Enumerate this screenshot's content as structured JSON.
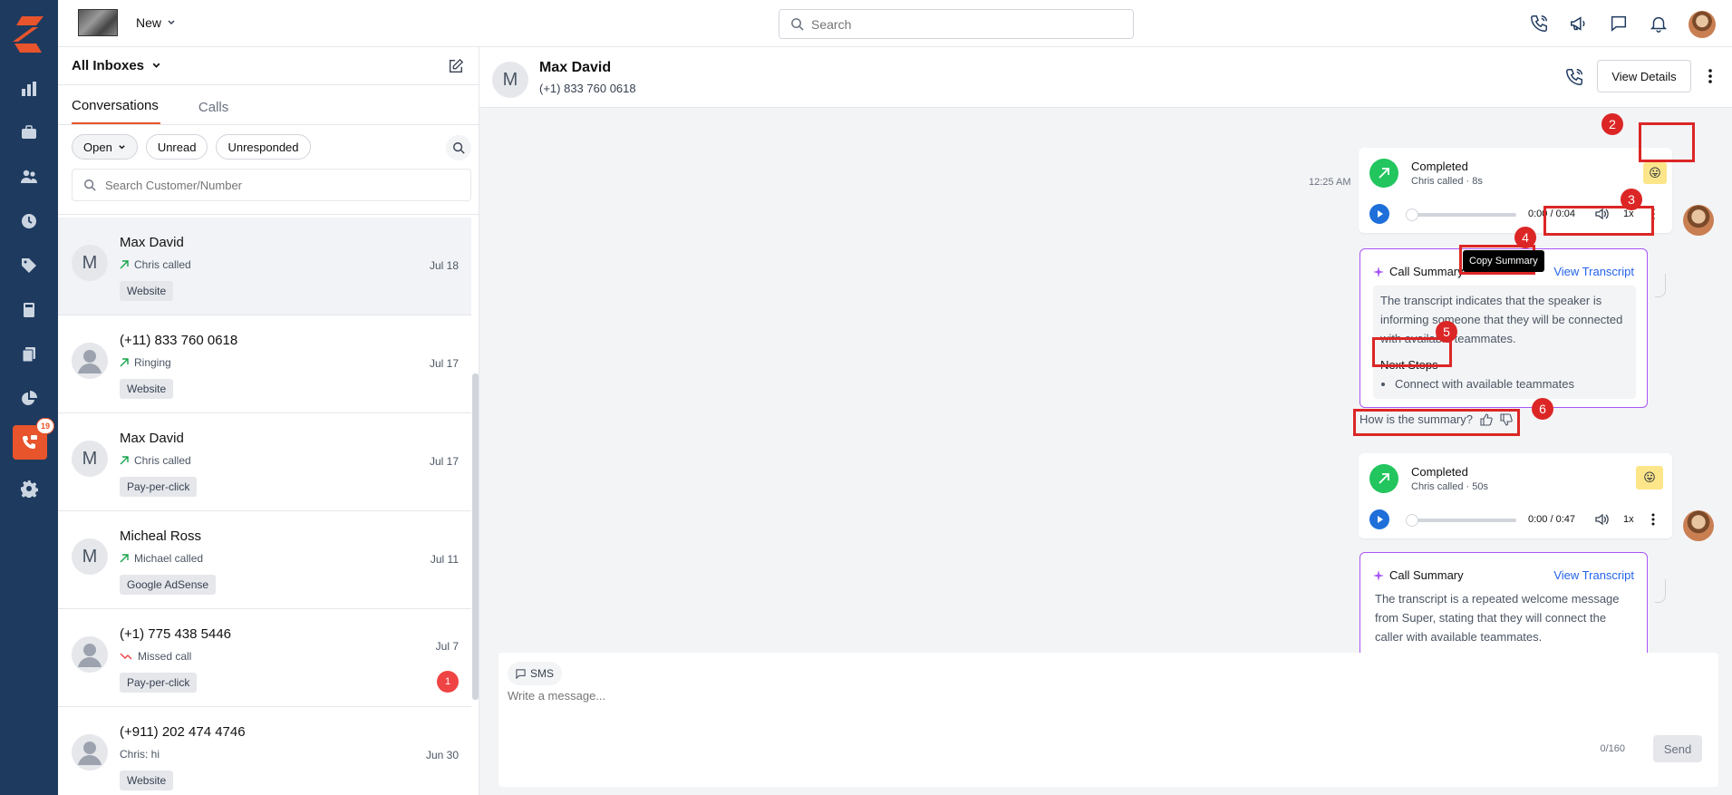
{
  "topbar": {
    "new_label": "New",
    "search_placeholder": "Search"
  },
  "nav": {
    "badge_count": "19",
    "items": [
      "dashboard-icon",
      "briefcase-icon",
      "users-icon",
      "clock-icon",
      "tag-icon",
      "calculator-icon",
      "documents-icon",
      "pie-chart-icon",
      "phone-chat-icon",
      "settings-icon"
    ]
  },
  "list": {
    "inbox_title": "All Inboxes",
    "tabs": [
      "Conversations",
      "Calls"
    ],
    "filters": [
      "Open",
      "Unread",
      "Unresponded"
    ],
    "search_placeholder": "Search Customer/Number",
    "conversations": [
      {
        "avatar": "M",
        "name": "Max David",
        "sub": "Chris called",
        "tag": "Website",
        "date": "Jul 18",
        "icon": "outgoing-call-icon"
      },
      {
        "avatar": "",
        "name": "(+11) 833 760 0618",
        "sub": "Ringing",
        "tag": "Website",
        "date": "Jul 17",
        "icon": "outgoing-call-icon"
      },
      {
        "avatar": "M",
        "name": "Max David",
        "sub": "Chris called",
        "tag": "Pay-per-click",
        "date": "Jul 17",
        "icon": "outgoing-call-icon"
      },
      {
        "avatar": "M",
        "name": "Micheal Ross",
        "sub": "Michael called",
        "tag": "Google AdSense",
        "date": "Jul 11",
        "icon": "outgoing-call-icon"
      },
      {
        "avatar": "",
        "name": "(+1) 775 438 5446",
        "sub": "Missed call",
        "tag": "Pay-per-click",
        "date": "Jul 7",
        "unread": "1",
        "icon": "missed-call-icon"
      },
      {
        "avatar": "",
        "name": "(+911) 202 474 4746",
        "sub": "Chris: hi",
        "tag": "Website",
        "date": "Jun 30",
        "icon": ""
      }
    ]
  },
  "chat": {
    "avatar": "M",
    "name": "Max David",
    "phone": "(+1) 833 760 0618",
    "view_details": "View Details",
    "timestamp": "12:25 AM",
    "calls": [
      {
        "status": "Completed",
        "who": "Chris called · 8s",
        "duration": "0:00 / 0:04",
        "speed": "1x",
        "emoji": "😛",
        "summary_title": "Call Summary",
        "view_transcript": "View Transcript",
        "summary_text": "The transcript indicates that the speaker is informing someone that they will be connected with available teammates.",
        "next_steps_label": "Next Steps",
        "next_steps": [
          "Connect with available teammates"
        ]
      },
      {
        "status": "Completed",
        "who": "Chris called · 50s",
        "duration": "0:00 / 0:47",
        "speed": "1x",
        "emoji": "😛",
        "summary_title": "Call Summary",
        "view_transcript": "View Transcript",
        "summary_text": "The transcript is a repeated welcome message from Super, stating that they will connect the caller with available teammates."
      }
    ],
    "feedback_question": "How is the summary?",
    "tooltip": "Copy Summary",
    "annotations": [
      "2",
      "3",
      "4",
      "5",
      "6"
    ],
    "composer": {
      "channel": "SMS",
      "placeholder": "Write a message...",
      "counter": "0/160",
      "send": "Send"
    }
  }
}
